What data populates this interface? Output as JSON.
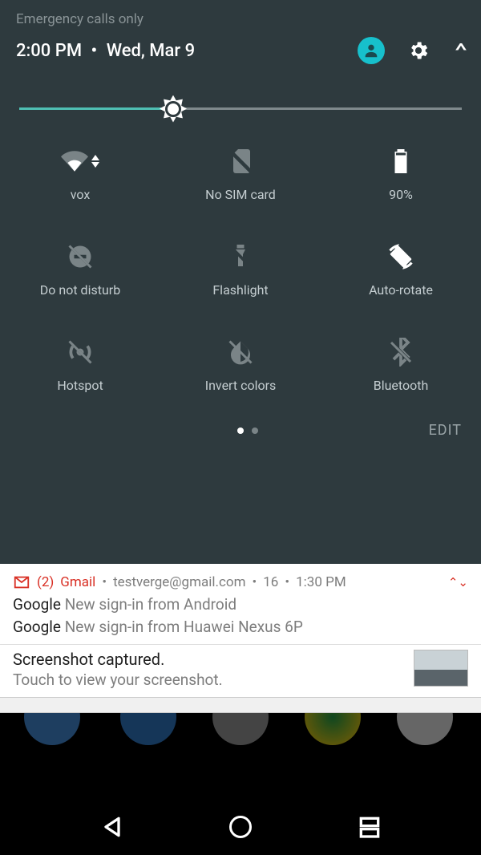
{
  "status": {
    "network": "Emergency calls only"
  },
  "header": {
    "time": "2:00 PM",
    "sep": "•",
    "date": "Wed, Mar 9"
  },
  "brightness": {
    "percent": 36
  },
  "tiles": [
    {
      "id": "wifi",
      "label": "vox",
      "active": true
    },
    {
      "id": "sim",
      "label": "No SIM card",
      "active": false
    },
    {
      "id": "battery",
      "label": "90%",
      "active": true
    },
    {
      "id": "dnd",
      "label": "Do not disturb",
      "active": false
    },
    {
      "id": "flashlight",
      "label": "Flashlight",
      "active": false
    },
    {
      "id": "autorotate",
      "label": "Auto-rotate",
      "active": true
    },
    {
      "id": "hotspot",
      "label": "Hotspot",
      "active": false
    },
    {
      "id": "invert",
      "label": "Invert colors",
      "active": false
    },
    {
      "id": "bluetooth",
      "label": "Bluetooth",
      "active": false
    }
  ],
  "footer": {
    "edit": "EDIT",
    "page": 0,
    "pages": 2
  },
  "notifications": {
    "gmail": {
      "count": "(2)",
      "app": "Gmail",
      "account": "testverge@gmail.com",
      "more": "16",
      "time": "1:30 PM",
      "items": [
        {
          "sender": "Google",
          "subject": "New sign-in from Android"
        },
        {
          "sender": "Google",
          "subject": "New sign-in from Huawei Nexus 6P"
        }
      ]
    },
    "screenshot": {
      "title": "Screenshot captured.",
      "sub": "Touch to view your screenshot."
    }
  }
}
